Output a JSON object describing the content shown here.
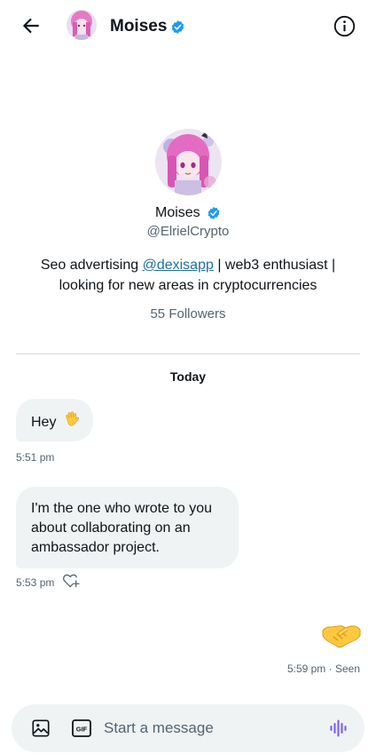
{
  "header": {
    "name": "Moises",
    "icons": {
      "back": "back-arrow-icon",
      "info": "info-icon",
      "verified": "verified-badge-icon"
    }
  },
  "profile": {
    "name": "Moises",
    "handle": "@ElrielCrypto",
    "bio_prefix": "Seo advertising ",
    "bio_link": "@dexisapp",
    "bio_line1_suffix": " | web3 enthusiast |",
    "bio_line2": "looking for new areas in cryptocurrencies",
    "followers": "55 Followers"
  },
  "conversation": {
    "day_label": "Today",
    "messages": [
      {
        "text": "Hey",
        "emoji": "waving-hand-icon",
        "time": "5:51 pm"
      },
      {
        "text": "I'm the one who wrote to you about collaborating on an ambassador project.",
        "time": "5:53 pm",
        "reaction_icon": "add-reaction-heart-icon"
      },
      {
        "emoji": "handshake-icon",
        "time": "5:59 pm · Seen"
      }
    ]
  },
  "composer": {
    "placeholder": "Start a message",
    "icons": [
      "image-icon",
      "gif-icon",
      "voice-message-icon"
    ]
  },
  "colors": {
    "accent": "#1d9bf0",
    "link": "#1d6fa5",
    "bubble": "#eff3f4",
    "voice": "#7856ff"
  }
}
